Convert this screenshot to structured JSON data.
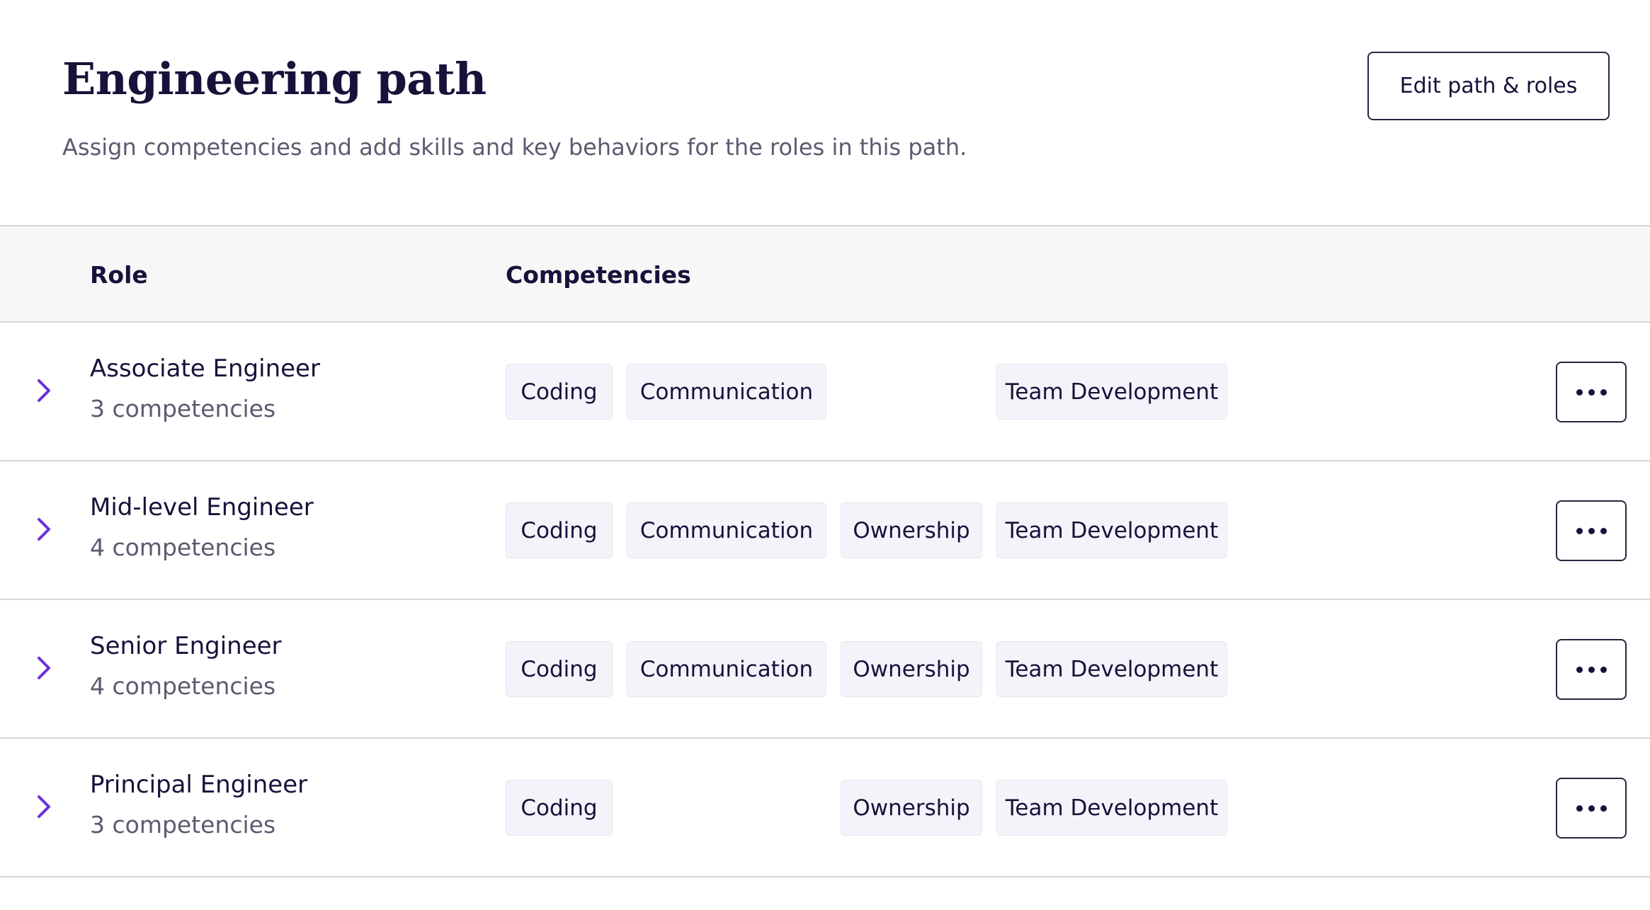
{
  "header": {
    "title": "Engineering path",
    "subtitle": "Assign competencies and add skills and key behaviors for the roles in this path.",
    "edit_button_label": "Edit path & roles"
  },
  "table": {
    "columns": {
      "role": "Role",
      "competencies": "Competencies"
    },
    "rows": [
      {
        "name": "Associate Engineer",
        "count": "3 competencies",
        "competencies": {
          "coding": "Coding",
          "communication": "Communication",
          "ownership": null,
          "team_development": "Team Development"
        }
      },
      {
        "name": "Mid-level Engineer",
        "count": "4 competencies",
        "competencies": {
          "coding": "Coding",
          "communication": "Communication",
          "ownership": "Ownership",
          "team_development": "Team Development"
        }
      },
      {
        "name": "Senior Engineer",
        "count": "4 competencies",
        "competencies": {
          "coding": "Coding",
          "communication": "Communication",
          "ownership": "Ownership",
          "team_development": "Team Development"
        }
      },
      {
        "name": "Principal Engineer",
        "count": "3 competencies",
        "competencies": {
          "coding": "Coding",
          "communication": null,
          "ownership": "Ownership",
          "team_development": "Team Development"
        }
      }
    ]
  },
  "icons": {
    "expand": "chevron-right-icon",
    "more": "more-horizontal-icon"
  },
  "colors": {
    "accent": "#6b2fd6",
    "text_primary": "#17123a",
    "text_secondary": "#5d5a70",
    "tag_background": "#f5f3fa",
    "header_row_background": "#f7f7f7",
    "divider": "#d6d6d6"
  }
}
